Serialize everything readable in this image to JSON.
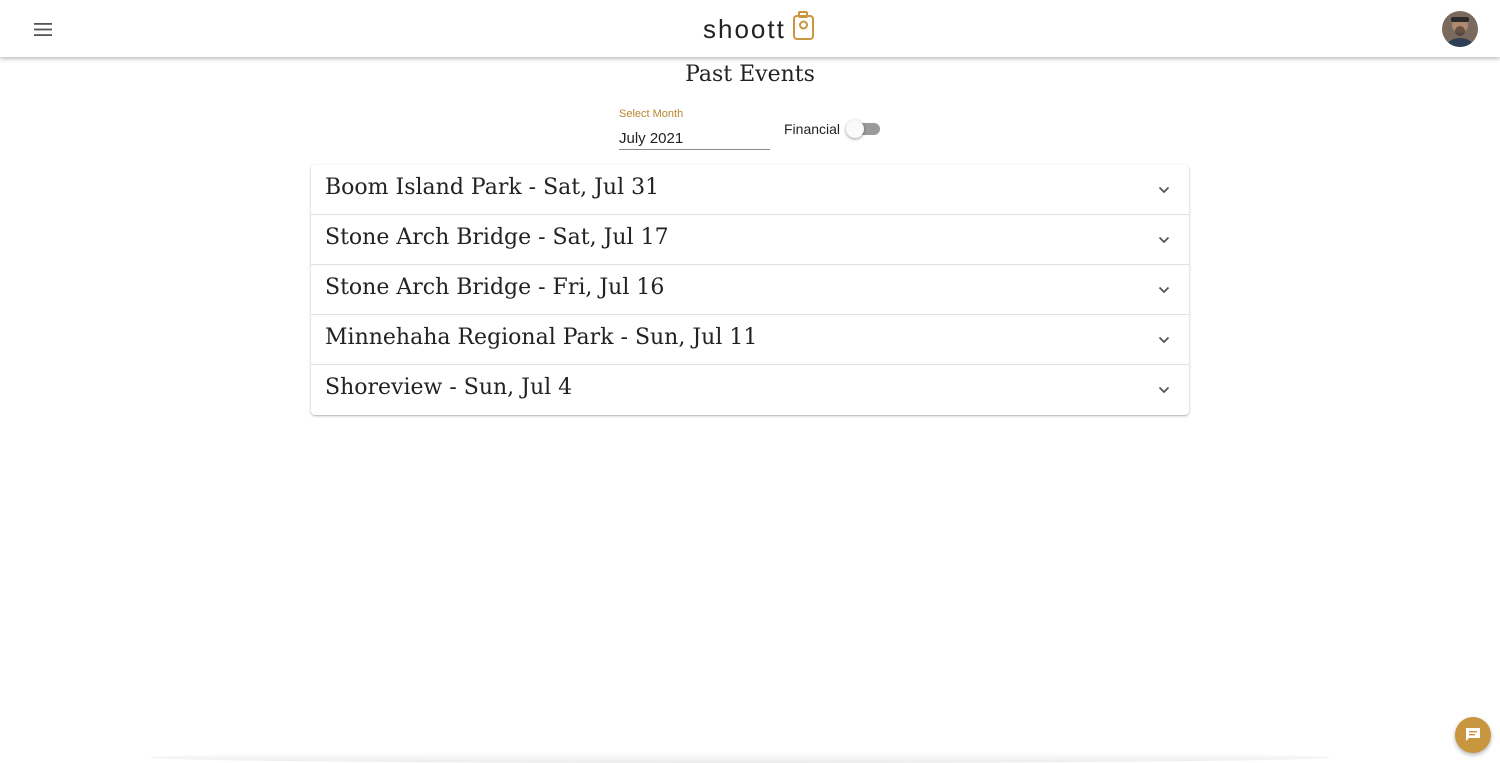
{
  "header": {
    "menu_icon": "hamburger-menu-icon",
    "logo_text": "shoott",
    "logo_icon": "camera-icon",
    "avatar_alt": "user-avatar",
    "brand_color": "#c8963e"
  },
  "page": {
    "title": "Past Events"
  },
  "filters": {
    "month_label": "Select Month",
    "month_value": "July 2021",
    "financial_label": "Financial",
    "financial_on": false
  },
  "events": [
    {
      "title": "Boom Island Park - Sat, Jul 31"
    },
    {
      "title": "Stone Arch Bridge - Sat, Jul 17"
    },
    {
      "title": "Stone Arch Bridge - Fri, Jul 16"
    },
    {
      "title": "Minnehaha Regional Park - Sun, Jul 11"
    },
    {
      "title": "Shoreview - Sun, Jul 4"
    }
  ],
  "chat": {
    "icon": "chat-icon"
  }
}
